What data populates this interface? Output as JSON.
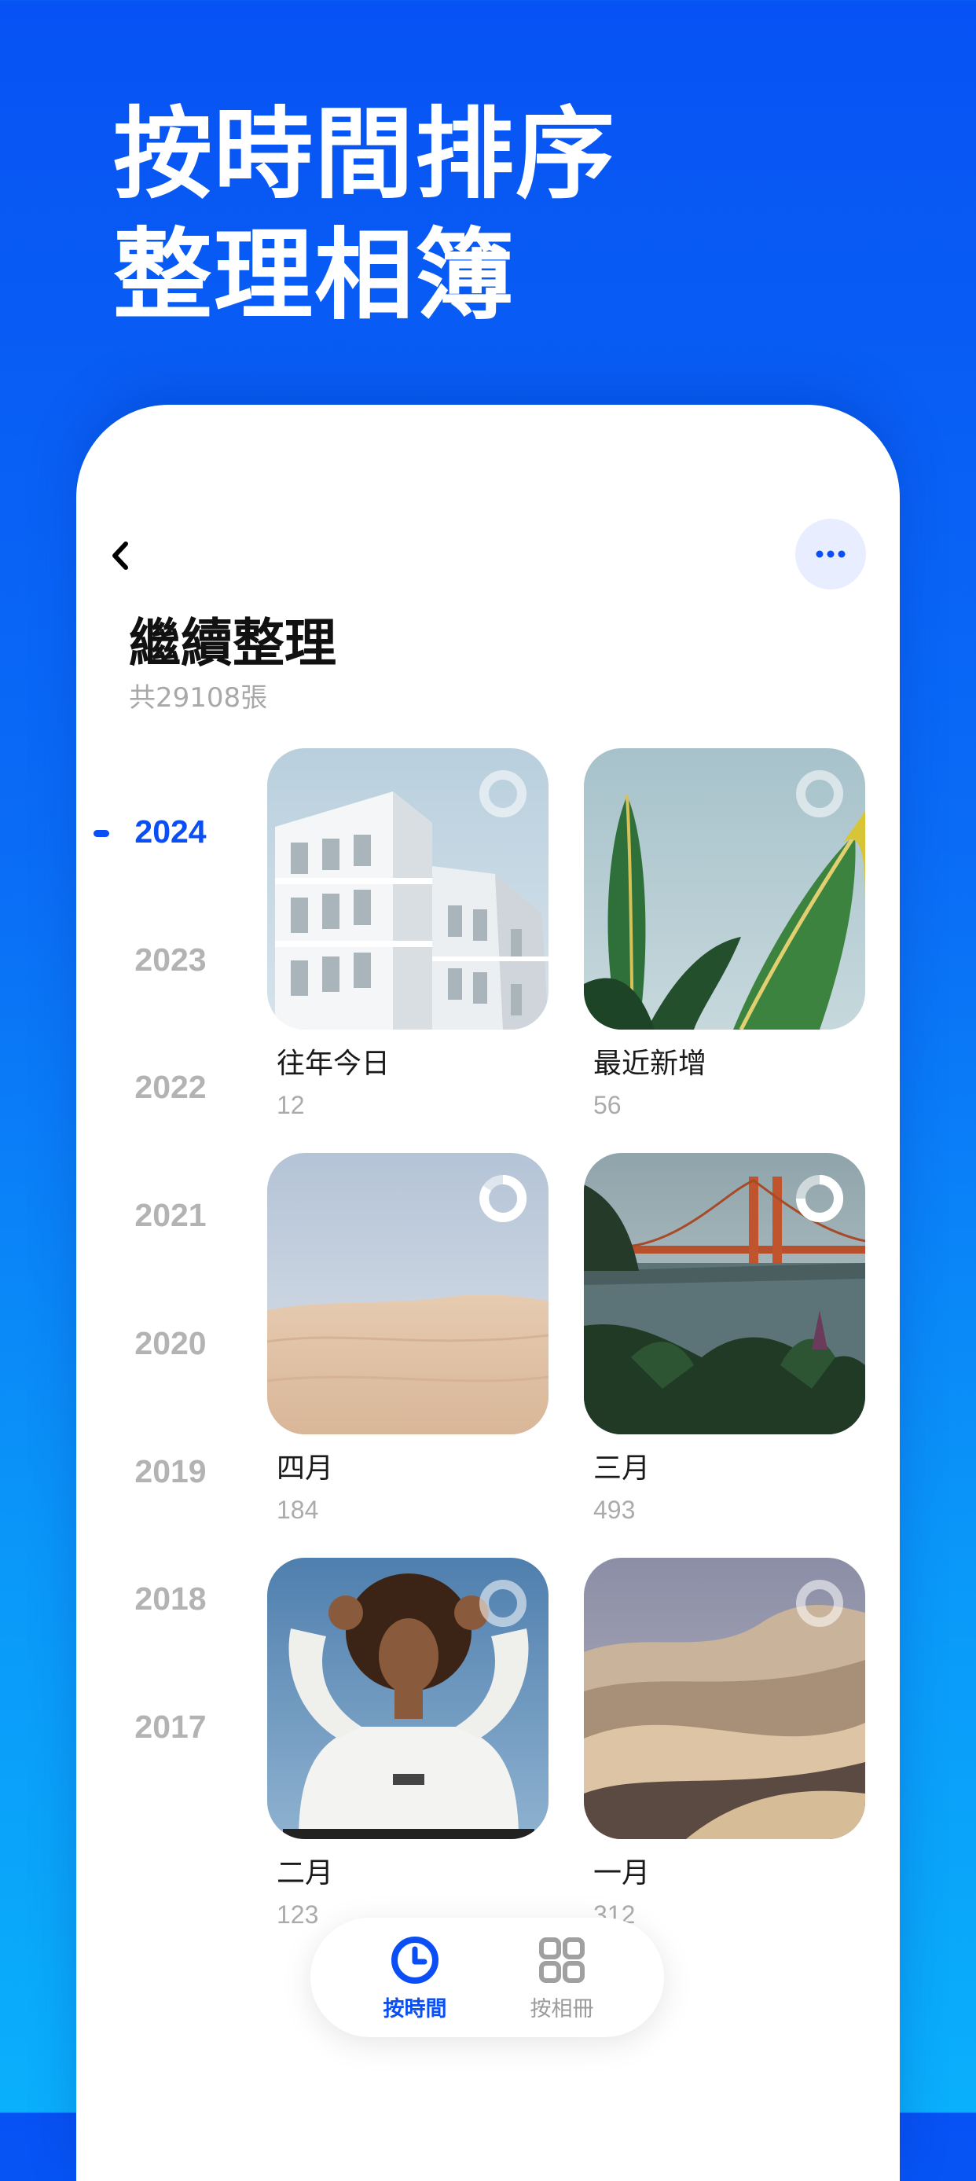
{
  "headline": {
    "line1": "按時間排序",
    "line2": "整理相簿"
  },
  "header": {
    "title": "繼續整理",
    "subtitle": "共29108張",
    "back_icon": "chevron-left-icon",
    "more_icon": "more-horizontal-icon"
  },
  "years": {
    "active": "2024",
    "items": [
      "2024",
      "2023",
      "2022",
      "2021",
      "2020",
      "2019",
      "2018",
      "2017"
    ]
  },
  "albums": [
    {
      "name": "往年今日",
      "count": "12"
    },
    {
      "name": "最近新增",
      "count": "56"
    },
    {
      "name": "四月",
      "count": "184"
    },
    {
      "name": "三月",
      "count": "493"
    },
    {
      "name": "二月",
      "count": "123"
    },
    {
      "name": "一月",
      "count": "312"
    }
  ],
  "tabbar": {
    "tabs": [
      {
        "label": "按時間",
        "icon": "clock-icon",
        "active": true
      },
      {
        "label": "按相冊",
        "icon": "grid-icon",
        "active": false
      }
    ]
  },
  "colors": {
    "accent": "#0a4ff5",
    "background_top": "#0752f4",
    "background_bottom": "#0ab0fb"
  }
}
